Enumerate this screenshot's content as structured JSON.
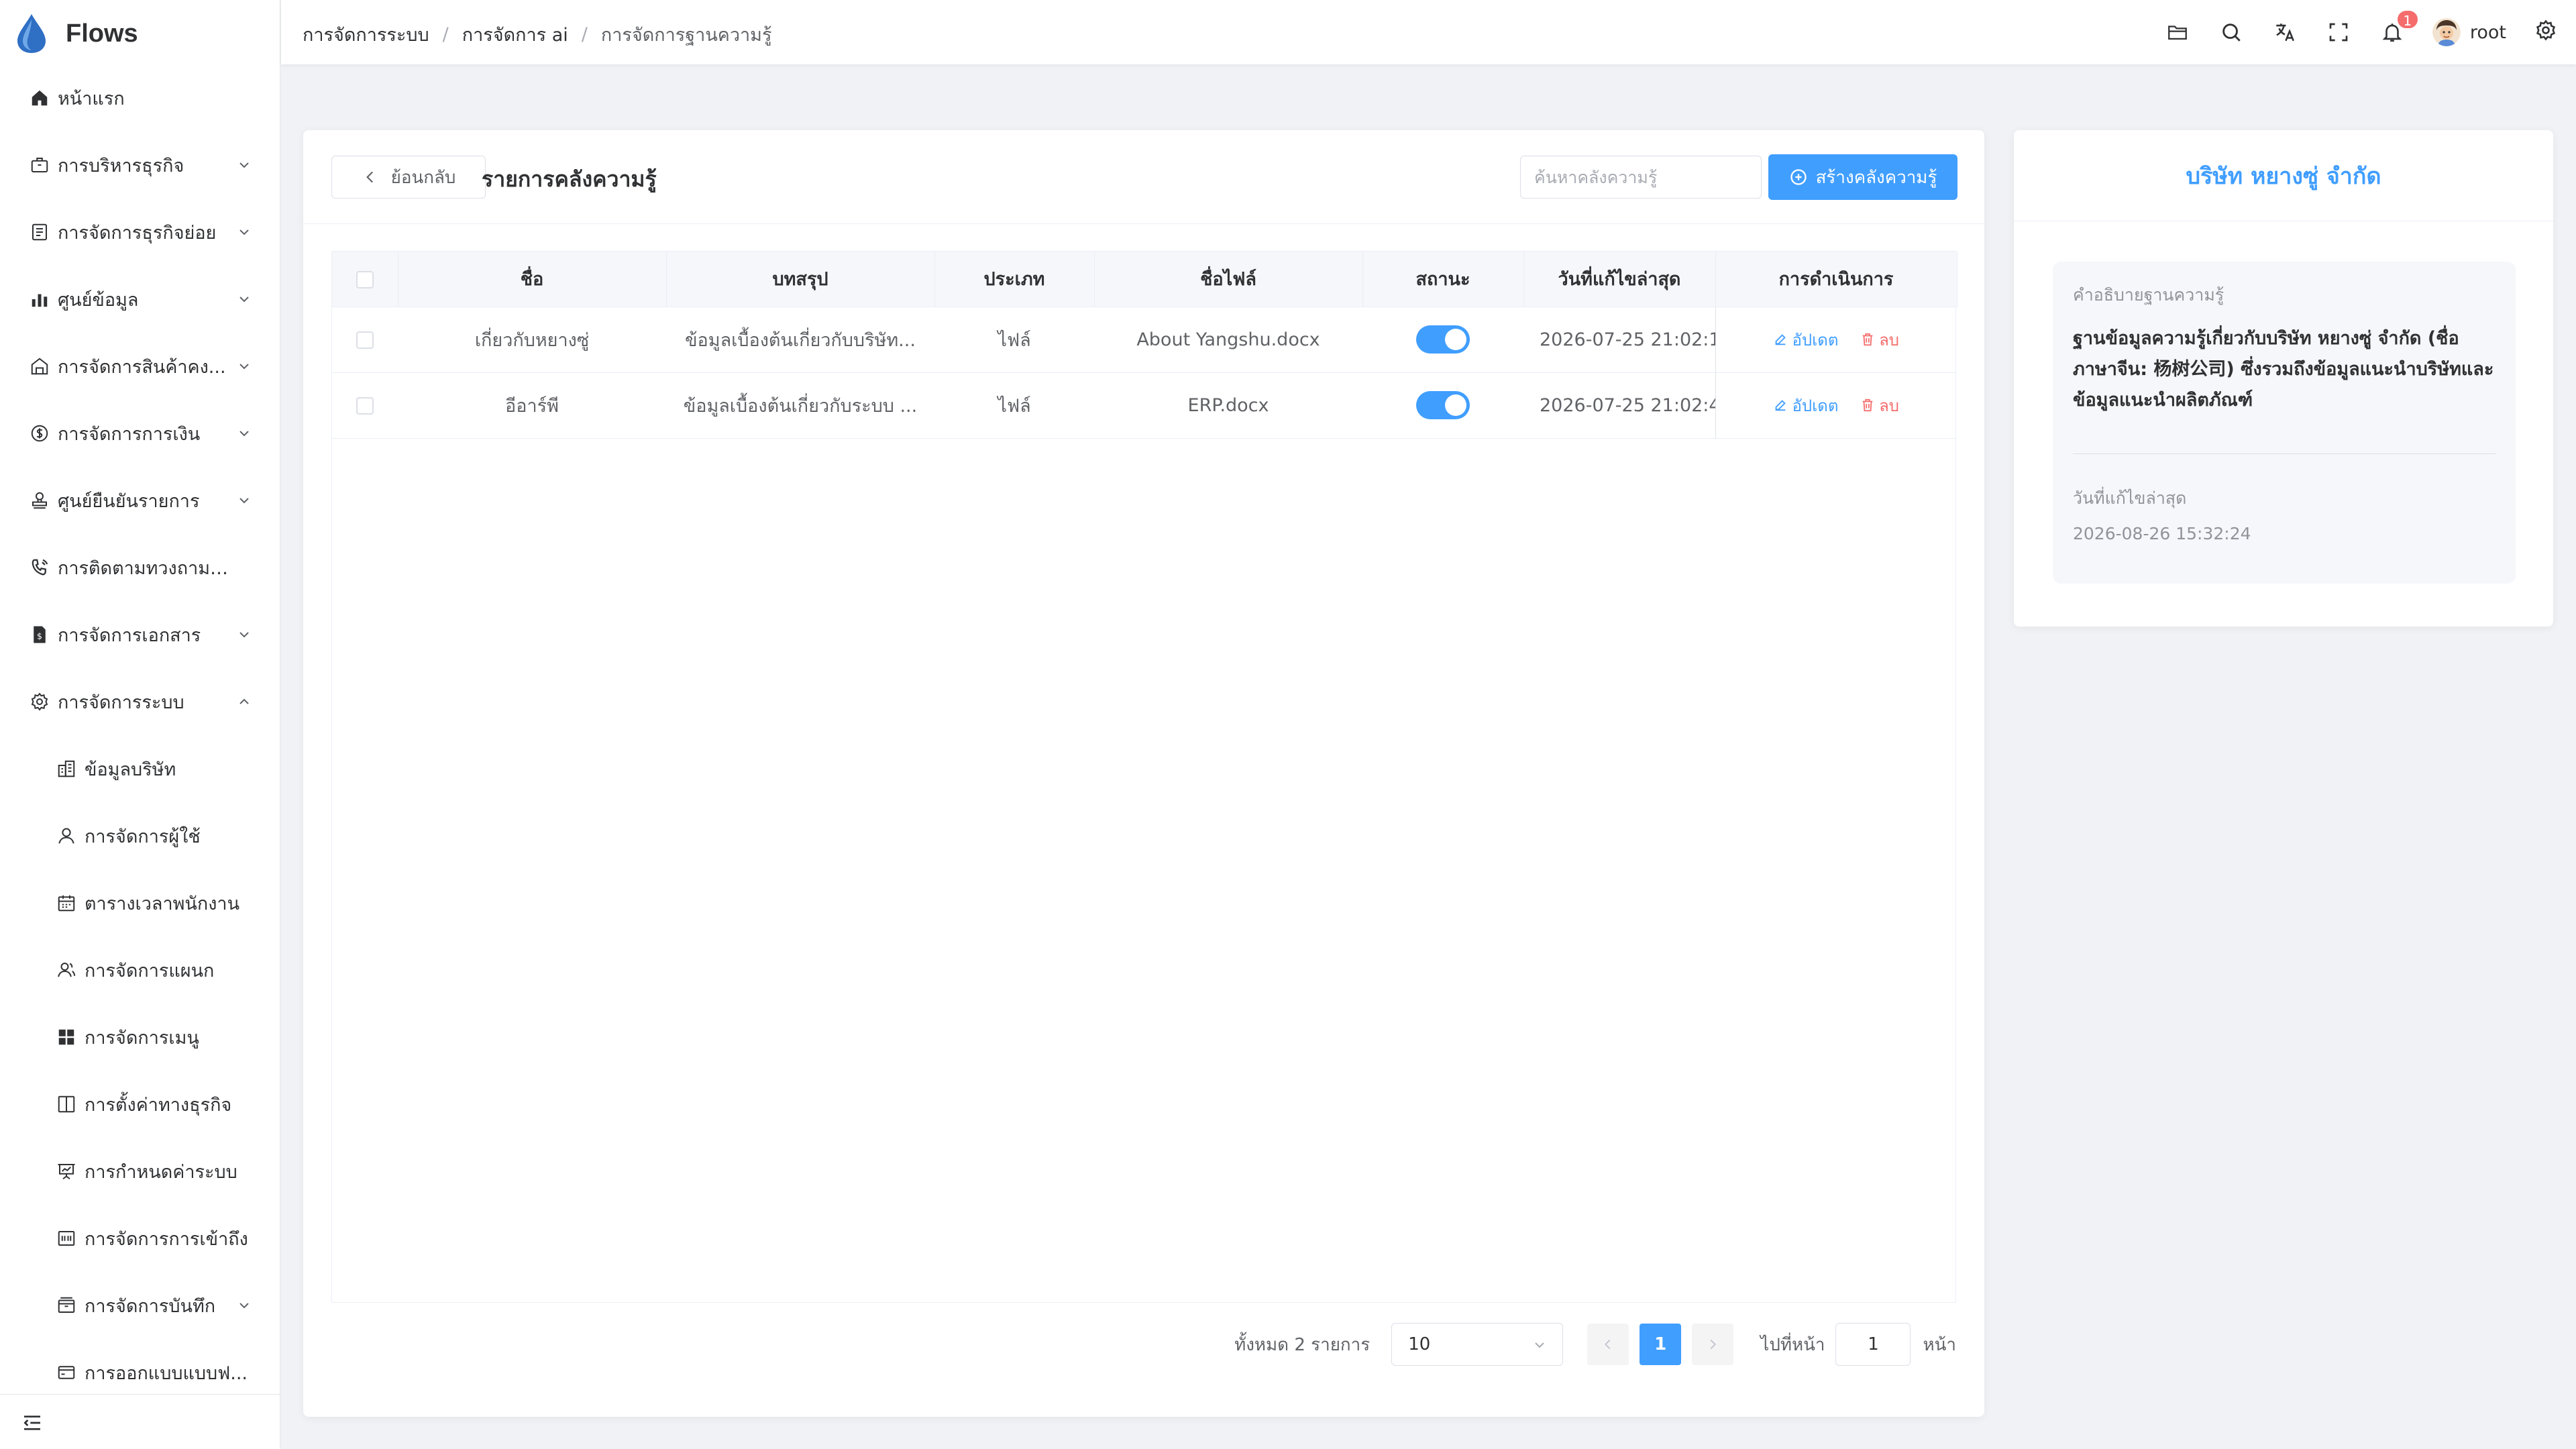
{
  "app": {
    "name": "Flows"
  },
  "sidebar": {
    "items": [
      {
        "label": "หน้าแรก",
        "icon": "home-icon",
        "chevron": ""
      },
      {
        "label": "การบริหารธุรกิจ",
        "icon": "briefcase-icon",
        "chevron": "down"
      },
      {
        "label": "การจัดการธุรกิจย่อย",
        "icon": "document-list-icon",
        "chevron": "down"
      },
      {
        "label": "ศูนย์ข้อมูล",
        "icon": "bar-chart-icon",
        "chevron": "down"
      },
      {
        "label": "การจัดการสินค้าคง...",
        "icon": "warehouse-icon",
        "chevron": "down"
      },
      {
        "label": "การจัดการการเงิน",
        "icon": "money-icon",
        "chevron": "down"
      },
      {
        "label": "ศูนย์ยืนยันรายการ",
        "icon": "stamp-icon",
        "chevron": "down"
      },
      {
        "label": "การติดตามทวงถามหนี้",
        "icon": "phone-icon",
        "chevron": ""
      },
      {
        "label": "การจัดการเอกสาร",
        "icon": "invoice-icon",
        "chevron": "down"
      },
      {
        "label": "การจัดการระบบ",
        "icon": "gear-icon",
        "chevron": "up"
      }
    ],
    "subitems": [
      {
        "label": "ข้อมูลบริษัท",
        "icon": "building-icon"
      },
      {
        "label": "การจัดการผู้ใช้",
        "icon": "user-icon"
      },
      {
        "label": "ตารางเวลาพนักงาน",
        "icon": "calendar-icon"
      },
      {
        "label": "การจัดการแผนก",
        "icon": "team-icon"
      },
      {
        "label": "การจัดการเมนู",
        "icon": "grid-icon"
      },
      {
        "label": "การตั้งค่าทางธุรกิจ",
        "icon": "book-icon"
      },
      {
        "label": "การกำหนดค่าระบบ",
        "icon": "presentation-icon"
      },
      {
        "label": "การจัดการการเข้าถึง",
        "icon": "access-icon"
      },
      {
        "label": "การจัดการบันทึก",
        "icon": "archive-icon",
        "chevron": "down"
      },
      {
        "label": "การออกแบบแบบฟ...",
        "icon": "form-icon"
      }
    ]
  },
  "header": {
    "breadcrumb": [
      "การจัดการระบบ",
      "การจัดการ ai",
      "การจัดการฐานความรู้"
    ],
    "separator": "/",
    "notification_count": "1",
    "username": "root",
    "icons": [
      "folder-icon",
      "search-icon",
      "translate-icon",
      "fullscreen-icon",
      "bell-icon",
      "gear-icon"
    ]
  },
  "main": {
    "back_label": "ย้อนกลับ",
    "title": "รายการคลังความรู้",
    "search_placeholder": "ค้นหาคลังความรู้",
    "create_label": "สร้างคลังความรู้",
    "table": {
      "columns": [
        "ชื่อ",
        "บทสรุป",
        "ประเภท",
        "ชื่อไฟล์",
        "สถานะ",
        "วันที่แก้ไขล่าสุด",
        "การดำเนินการ"
      ],
      "rows": [
        {
          "name": "เกี่ยวกับหยางซู่",
          "summary": "ข้อมูลเบื้องต้นเกี่ยวกับบริษัท...",
          "type": "ไฟล์",
          "file": "About Yangshu.docx",
          "status": true,
          "updated": "2026-07-25 21:02:1"
        },
        {
          "name": "อีอาร์พี",
          "summary": "ข้อมูลเบื้องต้นเกี่ยวกับระบบ ...",
          "type": "ไฟล์",
          "file": "ERP.docx",
          "status": true,
          "updated": "2026-07-25 21:02:4"
        }
      ],
      "edit_label": "อัปเดต",
      "delete_label": "ลบ"
    },
    "pagination": {
      "total_text": "ทั้งหมด 2 รายการ",
      "page_size": "10",
      "current_page": "1",
      "jump_label": "ไปที่หน้า",
      "jump_value": "1",
      "jump_suffix": "หน้า"
    }
  },
  "side_panel": {
    "title": "บริษัท หยางซู่ จำกัด",
    "desc_label": "คำอธิบายฐานความรู้",
    "description": "ฐานข้อมูลความรู้เกี่ยวกับบริษัท หยางซู่ จำกัด (ชื่อภาษาจีน: 杨树公司) ซึ่งรวมถึงข้อมูลแนะนำบริษัทและข้อมูลแนะนำผลิตภัณฑ์",
    "date_label": "วันที่แก้ไขล่าสุด",
    "date": "2026-08-26 15:32:24"
  },
  "colors": {
    "primary": "#409eff",
    "danger": "#f56c6c",
    "logo": "#2f6fc4"
  }
}
